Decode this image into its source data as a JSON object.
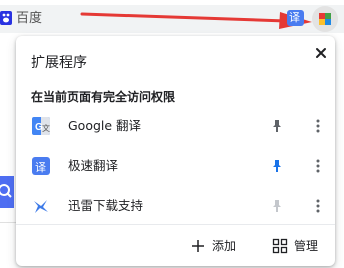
{
  "toolbar": {
    "omnibox_text": "百度",
    "ext_badge": "译"
  },
  "popup": {
    "title": "扩展程序",
    "section_title": "在当前页面有完全访问权限",
    "extensions": [
      {
        "name": "Google 翻译",
        "icon": "google-translate-icon",
        "pinned": false
      },
      {
        "name": "极速翻译",
        "icon": "fast-translate-icon",
        "pinned": true
      },
      {
        "name": "迅雷下载支持",
        "icon": "xunlei-icon",
        "pinned": false
      }
    ],
    "footer": {
      "add_label": "添加",
      "manage_label": "管理"
    }
  },
  "colors": {
    "accent": "#1a73e8",
    "annotation_arrow": "#e53935",
    "baidu_blue": "#4e6ef2"
  }
}
